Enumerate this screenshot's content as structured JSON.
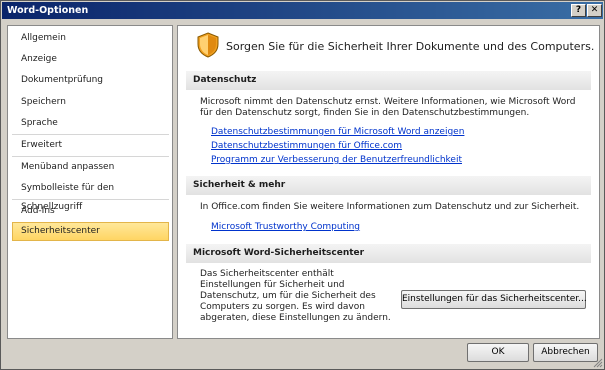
{
  "window": {
    "title": "Word-Optionen",
    "help_button": "?",
    "close_button": "✕"
  },
  "sidebar": {
    "items": [
      {
        "label": "Allgemein"
      },
      {
        "label": "Anzeige"
      },
      {
        "label": "Dokumentprüfung"
      },
      {
        "label": "Speichern"
      },
      {
        "label": "Sprache"
      },
      {
        "label": "Erweitert"
      },
      {
        "label": "Menüband anpassen"
      },
      {
        "label": "Symbolleiste für den Schnellzugriff"
      },
      {
        "label": "Add-Ins"
      },
      {
        "label": "Sicherheitscenter"
      }
    ],
    "selected_label": "Sicherheitscenter"
  },
  "main": {
    "headline": "Sorgen Sie für die Sicherheit Ihrer Dokumente und des Computers.",
    "header_icon": "shield-icon",
    "privacy": {
      "header": "Datenschutz",
      "text": "Microsoft nimmt den Datenschutz ernst. Weitere Informationen, wie Microsoft Word für den Datenschutz sorgt, finden Sie in den Datenschutzbestimmungen.",
      "links": [
        "Datenschutzbestimmungen für Microsoft Word anzeigen",
        "Datenschutzbestimmungen für Office.com",
        "Programm zur Verbesserung der Benutzerfreundlichkeit"
      ]
    },
    "security": {
      "header": "Sicherheit & mehr",
      "text": "In Office.com finden Sie weitere Informationen zum Datenschutz und zur Sicherheit.",
      "link": "Microsoft Trustworthy Computing"
    },
    "trust_center": {
      "header": "Microsoft Word-Sicherheitscenter",
      "text": "Das Sicherheitscenter enthält Einstellungen für Sicherheit und Datenschutz, um für die Sicherheit des Computers zu sorgen. Es wird davon abgeraten, diese Einstellungen zu ändern.",
      "button": "Einstellungen für das Sicherheitscenter..."
    }
  },
  "footer": {
    "ok": "OK",
    "cancel": "Abbrechen"
  },
  "colors": {
    "titlebar": "#0a246a",
    "selection": "#ffd563",
    "link": "#0033cc"
  }
}
